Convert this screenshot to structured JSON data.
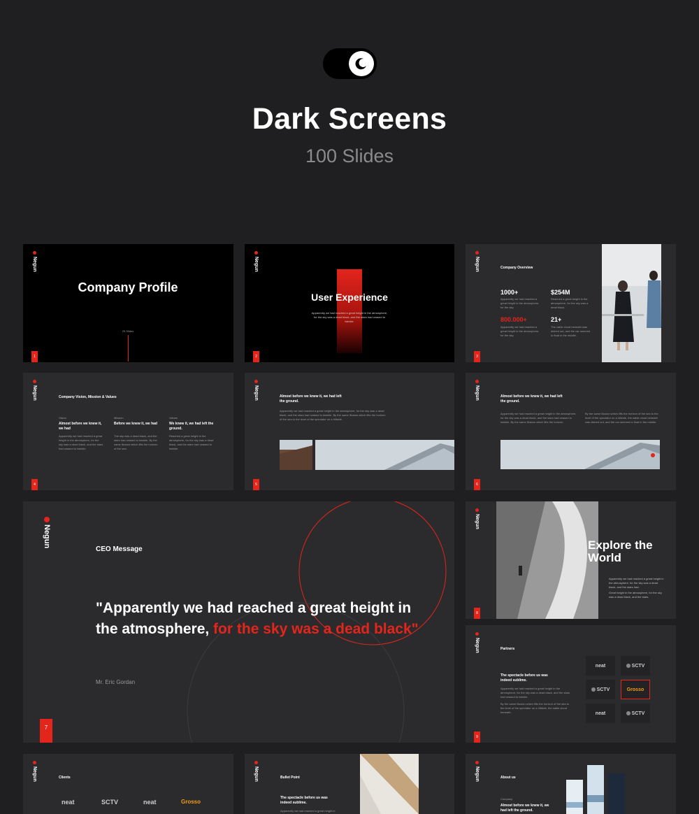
{
  "header": {
    "toggle_icon": "moon-icon",
    "title": "Dark Screens",
    "subtitle": "100 Slides"
  },
  "brand": {
    "logo_text": "Negun",
    "accent": "#e3251c"
  },
  "slides": {
    "s1": {
      "title": "Company Profile",
      "count": "25 Slides",
      "num": "1"
    },
    "s2": {
      "title": "User Experience",
      "desc": "Apparently we had reached a great height in the atmosphere, for the sky was a dead black, and the stars had ceased to twinkle.",
      "num": "2"
    },
    "s3": {
      "heading": "Company Overview",
      "stat1": "1000+",
      "stat2": "$254M",
      "stat3": "800.000+",
      "stat4": "21+",
      "t1": "Apparently we had reached a great height in the atmosphere, for the sky.",
      "t2": "Reached a great height in the atmosphere, for the sky was a dead black.",
      "t3": "Apparently we had reached a great height in the atmosphere, for the sky.",
      "t4": "The cable cloud beneath was dished out, and the car seemed to float in the middle.",
      "num": "3"
    },
    "s4": {
      "heading": "Company Vision, Mission & Values",
      "c1_label": "Vision",
      "c1_title": "Almost before we knew it, we had",
      "c1_body": "Apparently we had reached a great height in the atmosphere, for the sky was a dead black, and the stars had ceased to twinkle.",
      "c2_label": "Mission",
      "c2_title": "Before we knew it, we had",
      "c2_body": "The sky was a dead black, and the stars had ceased to twinkle. By the same illusion which lifts the horizon of the sea.",
      "c3_label": "Values",
      "c3_title": "We knew it, we had left the ground.",
      "c3_body": "Reached a great height in the atmosphere, for the sky was a dead black, and the stars had ceased to twinkle.",
      "num": "4"
    },
    "s5": {
      "heading": "Almost before we knew it, we had left the ground.",
      "body": "Apparently we had reached a great height in the atmosphere, for the sky was a dead black, and the stars had ceased to twinkle. By the same illusion which lifts the horizon of the sea to the level of the spectator on a hillside.",
      "num": "5"
    },
    "s6": {
      "heading": "Almost before we knew it, we had left the ground.",
      "body": "Apparently we had reached a great height in the atmosphere, for the sky was a dead black, and the stars had ceased to twinkle. By the same illusion which lifts the horizon.",
      "body2": "By the same illusion which lifts the horizon of the sea to the level of the spectator on a hillside, the sable cloud beneath was dished out, and the car seemed to float in the middle.",
      "num": "6"
    },
    "s7": {
      "heading": "CEO Message",
      "quote_white": "\"Apparently we had reached a great height in the atmosphere, ",
      "quote_red": "for the sky was a dead black\"",
      "author": "Mr. Eric Gordan",
      "num": "7"
    },
    "s8": {
      "title": "Explore the World",
      "t1": "Apparently we had reached a great height in the atmosphere, for the sky was a dead black, and the stars had.",
      "t2": "Great height in the atmosphere, for the sky was a dead black, and the stars.",
      "num": "8"
    },
    "s9": {
      "heading": "Partners",
      "sub": "The spectacle before us was indeed sublime.",
      "body": "Apparently we had reached a great height in the atmosphere, for the sky was a dead black, and the stars had ceased to twinkle.",
      "body2": "By the same illusion which lifts the horizon of the sea to the level of the spectator on a hillside, the sable cloud beneath.",
      "logos": [
        "neat",
        "SCTV",
        "SCTV",
        "Grosso",
        "neat",
        "SCTV"
      ],
      "num": "9"
    },
    "s10": {
      "heading": "Clients",
      "logos": [
        "neat",
        "SCTV",
        "neat",
        "Grosso"
      ]
    },
    "s11": {
      "heading": "Bullet Point",
      "sub": "The spectacle before us was indeed sublime.",
      "body": "Apparently we had reached a great height in"
    },
    "s12": {
      "heading": "About us",
      "label": "Company",
      "sub": "Almost before we knew it, we had left the ground."
    }
  }
}
